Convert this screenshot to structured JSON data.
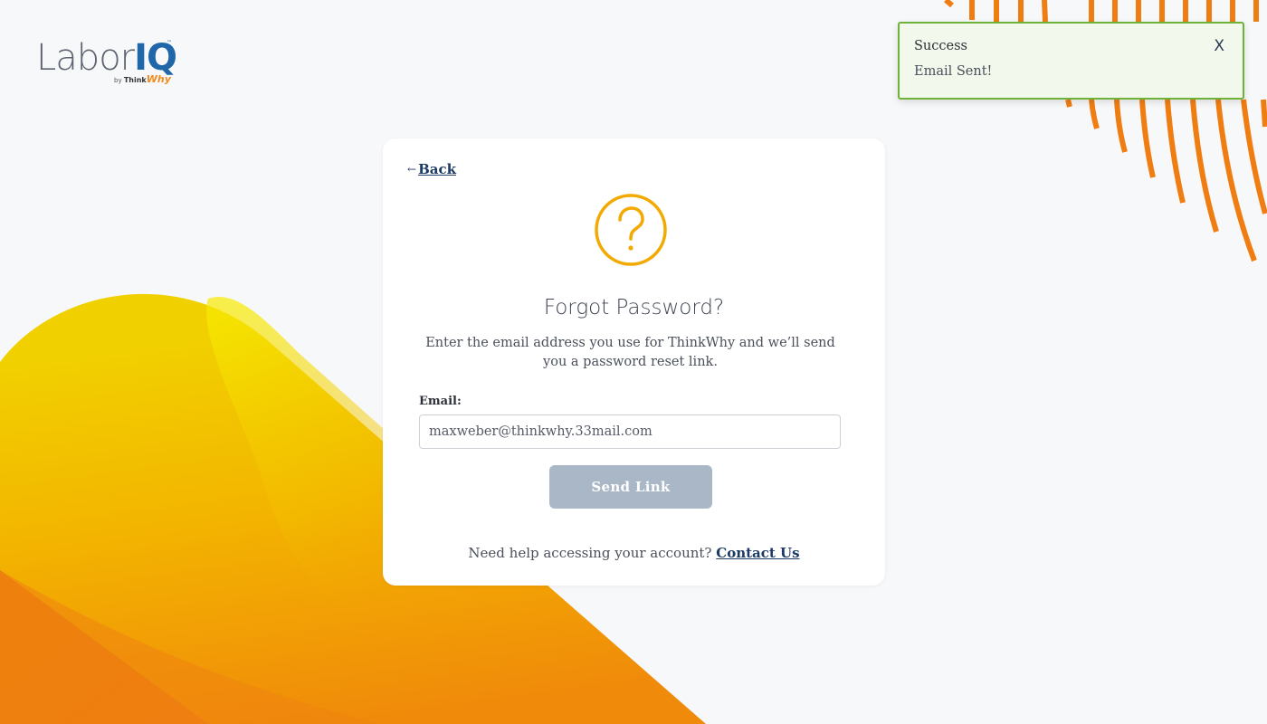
{
  "app": {
    "logo_labor": "Labor",
    "logo_iq": "IQ",
    "logo_by": "by",
    "logo_think": "Think",
    "logo_why": "Why",
    "logo_tm": "™"
  },
  "card": {
    "back_label": "Back",
    "back_arrow": "←",
    "icon": "question-circle-icon",
    "title": "Forgot Password?",
    "description": "Enter the email address you use for ThinkWhy and we’ll send you a password reset link.",
    "email_label": "Email:",
    "email_value": "maxweber@thinkwhy.33mail.com",
    "send_button": "Send Link",
    "help_text": "Need help accessing your account?",
    "contact_link": "Contact Us"
  },
  "toast": {
    "title": "Success",
    "message": "Email Sent!",
    "close_glyph": "X"
  },
  "colors": {
    "accent_navy": "#1d3a64",
    "icon_amber": "#f2a900",
    "success_green": "#6fb23a",
    "button_disabled": "#a9b7c6",
    "brand_orange": "#f07d12",
    "brand_blue": "#1f67a8"
  }
}
